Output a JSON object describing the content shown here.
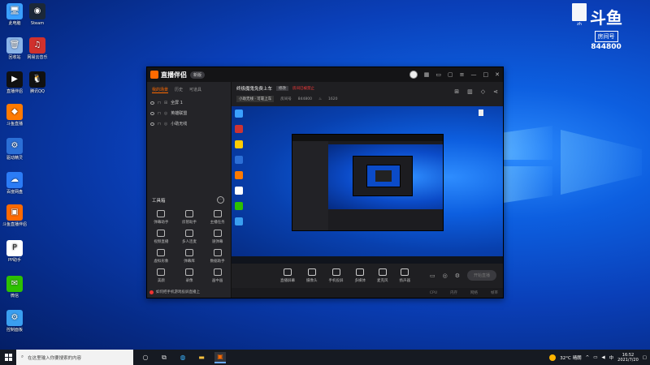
{
  "desktop": {
    "icons": [
      {
        "label": "此电脑",
        "color": "#3aa0ff",
        "glyph": "🖥"
      },
      {
        "label": "Steam",
        "color": "#1b2838",
        "glyph": "◉"
      },
      {
        "label": "回收站",
        "color": "#8ab4e8",
        "glyph": "🗑"
      },
      {
        "label": "网易云音乐",
        "color": "#d0312d",
        "glyph": "♫"
      },
      {
        "label": "直播伴侣",
        "color": "#111111",
        "glyph": "▶"
      },
      {
        "label": "腾讯QQ",
        "color": "#111111",
        "glyph": "🐧"
      },
      {
        "label": "斗鱼直播",
        "color": "#ff7a00",
        "glyph": "◆"
      },
      {
        "label": "驱动精灵",
        "color": "#2b6fd6",
        "glyph": "⚙"
      },
      {
        "label": "百度网盘",
        "color": "#2b7cf6",
        "glyph": "☁"
      },
      {
        "label": "斗鱼直播伴侣",
        "color": "#ff6a00",
        "glyph": "▣"
      },
      {
        "label": "PP助手",
        "color": "#ffffff",
        "glyph": "P"
      },
      {
        "label": "微信",
        "color": "#2dc100",
        "glyph": "✉"
      },
      {
        "label": "控制面板",
        "color": "#3a9ff0",
        "glyph": "⚙"
      }
    ],
    "file_icon_label": "zh",
    "brand": {
      "logo": "斗鱼",
      "room_label": "房间号",
      "room_number": "844800"
    }
  },
  "app": {
    "title": "直播伴侣",
    "version_badge": "新版",
    "sidebar": {
      "tabs": [
        "我的场景",
        "历史",
        "可道具"
      ],
      "scenes": [
        "全屏 1",
        "英雄联盟",
        "小助无线"
      ],
      "tools_title": "工具箱",
      "tools": [
        "弹幕助手",
        "房管助手",
        "主播任务",
        "视频直播",
        "多人连麦",
        "速弹幕",
        "虚拟形象",
        "弹幕库",
        "数据助手",
        "美颜",
        "录像",
        "画中画"
      ],
      "phone_tip": "如何把手机游戏投屏直播上"
    },
    "room": {
      "title": "终极魔鬼免费上车",
      "edit_tag": "修改",
      "warning": "房间已被禁止",
      "category": "小助无线 · 可靠上车",
      "room_no_label": "房间号",
      "room_no": "844800",
      "hot": "1620"
    },
    "controls": [
      "直播屏幕",
      "摄像头",
      "手机投屏",
      "多媒体",
      "麦克风",
      "扬声器"
    ],
    "start_button": "开始直播",
    "status": [
      "CPU",
      "内存",
      "网络",
      "帧率"
    ]
  },
  "taskbar": {
    "search_placeholder": "在这里输入你要搜索的内容",
    "weather": "32°C 晴朗",
    "time": "16:52",
    "date": "2021/7/20"
  }
}
